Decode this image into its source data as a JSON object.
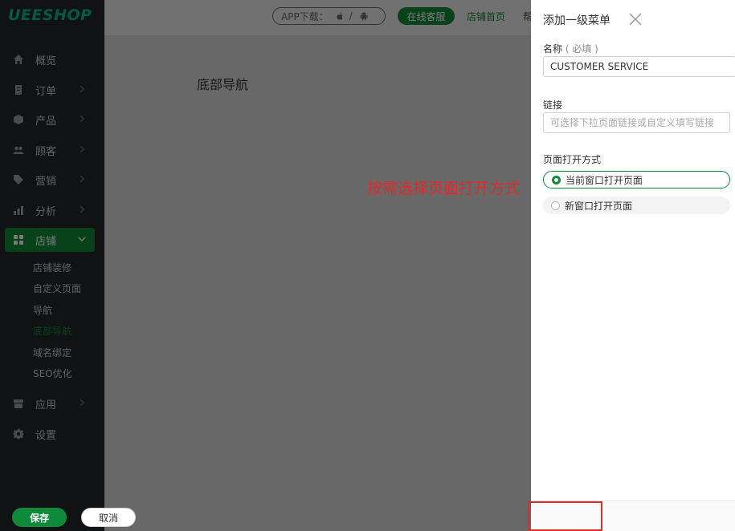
{
  "brand": {
    "logo_text": "UEESHOP",
    "accent_color": "#0f8a3a"
  },
  "topbar": {
    "app_download_label": "APP下载：",
    "app_download_icons": [
      "apple-icon",
      "android-icon"
    ],
    "app_separator": "/",
    "online_service_label": "在线客服",
    "store_home_label": "店铺首页",
    "truncated_link_label": "帮"
  },
  "sidebar": {
    "items": [
      {
        "label": "概览",
        "icon": "home-icon",
        "has_children": false
      },
      {
        "label": "订单",
        "icon": "order-icon",
        "has_children": true
      },
      {
        "label": "产品",
        "icon": "box-icon",
        "has_children": true
      },
      {
        "label": "顾客",
        "icon": "users-icon",
        "has_children": true
      },
      {
        "label": "营销",
        "icon": "tag-icon",
        "has_children": true
      },
      {
        "label": "分析",
        "icon": "bar-chart-icon",
        "has_children": true
      },
      {
        "label": "店铺",
        "icon": "grid-icon",
        "has_children": true,
        "active": true
      },
      {
        "label": "应用",
        "icon": "app-icon",
        "has_children": true
      },
      {
        "label": "设置",
        "icon": "gear-icon",
        "has_children": false
      }
    ],
    "store_subitems": [
      {
        "label": "店铺装修"
      },
      {
        "label": "自定义页面"
      },
      {
        "label": "导航"
      },
      {
        "label": "底部导航",
        "current": true
      },
      {
        "label": "域名绑定"
      },
      {
        "label": "SEO优化"
      }
    ]
  },
  "main": {
    "page_title": "底部导航"
  },
  "annotation": {
    "text": "按需选择页面打开方式",
    "color": "#e12a2a"
  },
  "panel": {
    "title": "添加一级菜单",
    "name_label": "名称",
    "name_required": "( 必填 )",
    "name_value": "CUSTOMER SERVICE",
    "link_label": "链接",
    "link_placeholder": "可选择下拉页面链接或自定义填写链接",
    "open_mode_label": "页面打开方式",
    "open_mode_options": [
      {
        "label": "当前窗口打开页面",
        "selected": true
      },
      {
        "label": "新窗口打开页面",
        "selected": false
      }
    ],
    "save_label": "保存",
    "cancel_label": "取消"
  }
}
